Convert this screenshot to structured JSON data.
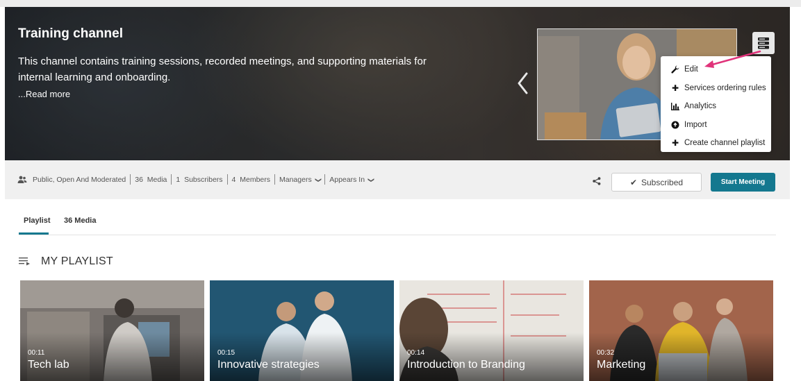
{
  "hero": {
    "title": "Training channel",
    "description": "This channel contains training sessions, recorded meetings, and supporting materials for internal learning and onboarding.",
    "read_more": "...Read more"
  },
  "actions_menu": {
    "items": [
      {
        "label": "Edit",
        "icon": "wrench-icon"
      },
      {
        "label": "Services ordering rules",
        "icon": "plus-icon"
      },
      {
        "label": "Analytics",
        "icon": "bar-chart-icon"
      },
      {
        "label": "Import",
        "icon": "circle-arrow-icon"
      },
      {
        "label": "Create channel playlist",
        "icon": "plus-icon"
      }
    ]
  },
  "meta": {
    "privacy": "Public, Open And Moderated",
    "media_count": "36",
    "media_label": "Media",
    "subscribers_count": "1",
    "subscribers_label": "Subscribers",
    "members_count": "4",
    "members_label": "Members",
    "managers_label": "Managers",
    "appears_in_label": "Appears In"
  },
  "buttons": {
    "subscribed": "Subscribed",
    "start_meeting": "Start Meeting"
  },
  "tabs": [
    {
      "label": "Playlist",
      "active": true
    },
    {
      "label": "36 Media",
      "active": false
    }
  ],
  "playlist": {
    "title": "MY PLAYLIST",
    "items": [
      {
        "duration": "00:11",
        "title": "Tech lab"
      },
      {
        "duration": "00:15",
        "title": "Innovative strategies"
      },
      {
        "duration": "00:14",
        "title": "Introduction to Branding"
      },
      {
        "duration": "00:32",
        "title": "Marketing"
      }
    ]
  },
  "colors": {
    "accent": "#14788f",
    "annotation_arrow": "#e0337a"
  }
}
